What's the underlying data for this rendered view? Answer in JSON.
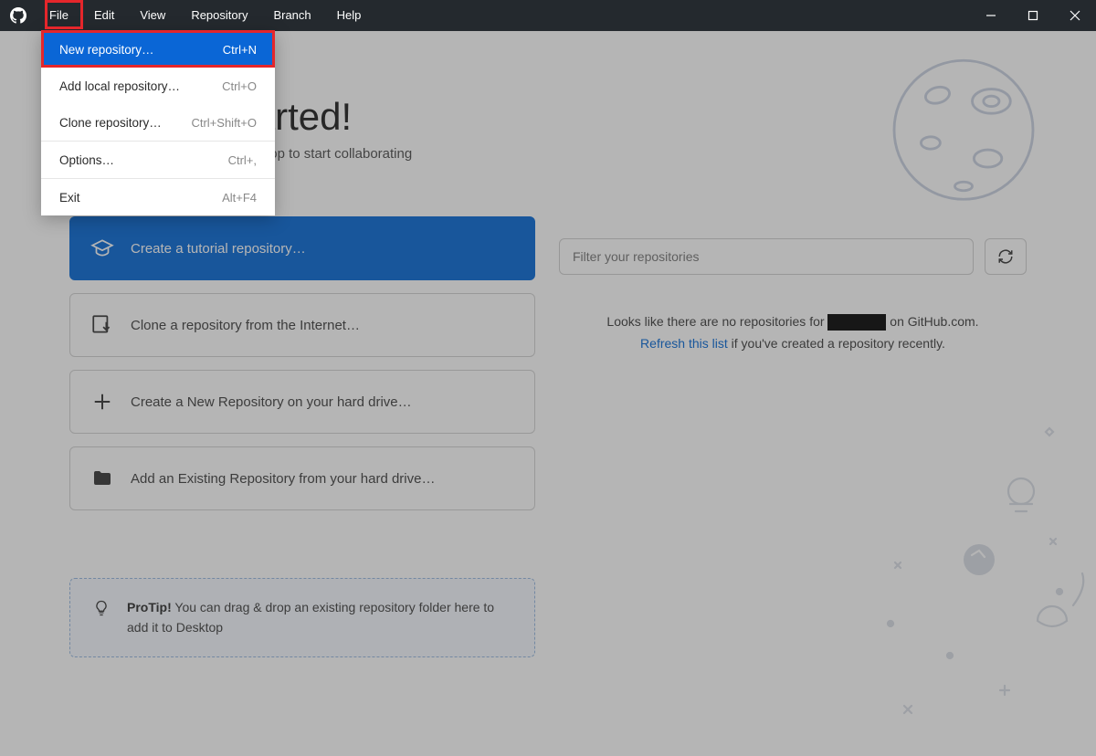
{
  "menubar": {
    "items": [
      "File",
      "Edit",
      "View",
      "Repository",
      "Branch",
      "Help"
    ]
  },
  "file_menu": {
    "items": [
      {
        "label": "New repository…",
        "shortcut": "Ctrl+N",
        "selected": true
      },
      {
        "label": "Add local repository…",
        "shortcut": "Ctrl+O"
      },
      {
        "label": "Clone repository…",
        "shortcut": "Ctrl+Shift+O"
      },
      {
        "label": "Options…",
        "shortcut": "Ctrl+,"
      },
      {
        "label": "Exit",
        "shortcut": "Alt+F4"
      }
    ]
  },
  "welcome": {
    "title": "Let's get started!",
    "subtitle": "Add a repository to GitHub Desktop to start collaborating"
  },
  "cards": {
    "tutorial": "Create a tutorial repository…",
    "clone": "Clone a repository from the Internet…",
    "create_new": "Create a New Repository on your hard drive…",
    "add_existing": "Add an Existing Repository from your hard drive…"
  },
  "protip": {
    "label": "ProTip!",
    "text": " You can drag & drop an existing repository folder here to add it to Desktop"
  },
  "filter": {
    "placeholder": "Filter your repositories"
  },
  "empty_state": {
    "line1_pre": "Looks like there are no repositories for ",
    "line1_post": " on GitHub.com.",
    "link": "Refresh this list",
    "line2_rest": " if you've created a repository recently."
  }
}
